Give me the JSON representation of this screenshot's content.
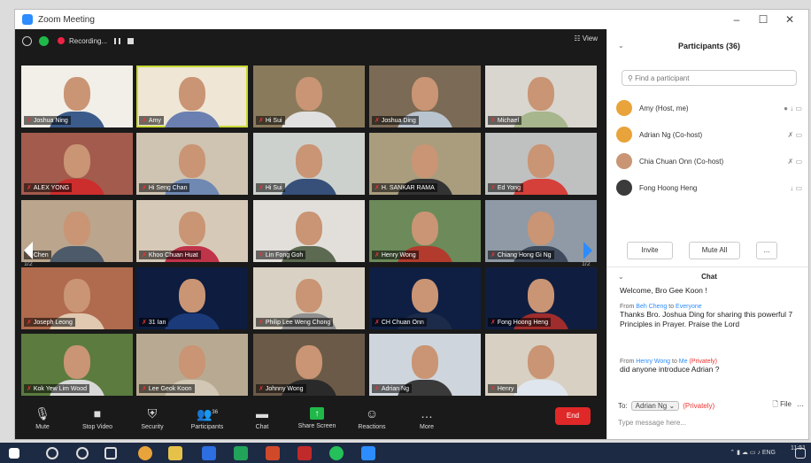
{
  "window": {
    "title": "Zoom Meeting"
  },
  "titlebar_controls": [
    "–",
    "☐",
    "✕"
  ],
  "top_bar": {
    "recording_label": "Recording...",
    "view_label": "View"
  },
  "tiles": [
    {
      "name": "Joshua Ning",
      "bg": "#f2efe8",
      "shirt": "#3b5b8a"
    },
    {
      "name": "Amy",
      "bg": "#efe6d6",
      "shirt": "#6b7fb0"
    },
    {
      "name": "Hi Sui",
      "bg": "#8a7a5c",
      "shirt": "#e0e0e0"
    },
    {
      "name": "Joshua Ding",
      "bg": "#7b6a55",
      "shirt": "#b9c4cf"
    },
    {
      "name": "Michael",
      "bg": "#d9d6cf",
      "shirt": "#a7b68c"
    },
    {
      "name": "ALEX YONG",
      "bg": "#a35b4e",
      "shirt": "#cc2d2d"
    },
    {
      "name": "Hi Seng Chan",
      "bg": "#cfc3b2",
      "shirt": "#6f89b3"
    },
    {
      "name": "Hi Sui",
      "bg": "#cdd1cd",
      "shirt": "#36507a"
    },
    {
      "name": "H. SANKAR RAMA",
      "bg": "#a99d7e",
      "shirt": "#333333"
    },
    {
      "name": "Ed Yong",
      "bg": "#bfc0c0",
      "shirt": "#d6403a"
    },
    {
      "name": "Chen",
      "bg": "#bba58d",
      "shirt": "#4c5a6a"
    },
    {
      "name": "Khoo Chuan Huat",
      "bg": "#d7c9b8",
      "shirt": "#c0344a"
    },
    {
      "name": "Lin Fong Goh",
      "bg": "#e2dfdb",
      "shirt": "#5d6a52"
    },
    {
      "name": "Henry Wong",
      "bg": "#6c8a5a",
      "shirt": "#b23b2e"
    },
    {
      "name": "Chiang Hong Gi Ng",
      "bg": "#8f9aa6",
      "shirt": "#3f4a5c"
    },
    {
      "name": "Joseph Leong",
      "bg": "#b06a4d",
      "shirt": "#e0c9b0"
    },
    {
      "name": "31 Ian",
      "bg": "#0d1c3f",
      "shirt": "#1b3a7a"
    },
    {
      "name": "Philip Lee Weng Chong",
      "bg": "#d9d2c4",
      "shirt": "#909090"
    },
    {
      "name": "CH Chuan Onn",
      "bg": "#0e1f43",
      "shirt": "#1d2b4a"
    },
    {
      "name": "Fong Hoong Heng",
      "bg": "#0f1e40",
      "shirt": "#a02d2d"
    },
    {
      "name": "Kok Yew Lim Wood",
      "bg": "#5b7b3f",
      "shirt": "#d8d8d8"
    },
    {
      "name": "Lee Geok Koon",
      "bg": "#b8aa92",
      "shirt": "#d2c7b4"
    },
    {
      "name": "Johnny Wong",
      "bg": "#6b5a48",
      "shirt": "#2a2a2a"
    },
    {
      "name": "Adrian Ng",
      "bg": "#cfd5dc",
      "shirt": "#3a3a3a"
    },
    {
      "name": "Henry",
      "bg": "#d8d0c2",
      "shirt": "#dfe6ee"
    }
  ],
  "page_indicator": [
    "1/2",
    "1/2"
  ],
  "toolbar": {
    "mute": "Mute",
    "stop_video": "Stop Video",
    "security": "Security",
    "participants": "Participants",
    "participants_count": "36",
    "chat": "Chat",
    "share": "Share Screen",
    "reactions": "Reactions",
    "more": "More",
    "end": "End"
  },
  "panel": {
    "title": "Participants (36)",
    "search_placeholder": "Find a participant",
    "participants": [
      {
        "name": "Amy (Host, me)",
        "icons": "● ↓ ▭",
        "avatar": "#e8a33a"
      },
      {
        "name": "Adrian Ng (Co-host)",
        "icons": "✗ ▭",
        "avatar": "#e8a33a"
      },
      {
        "name": "Chia Chuan Onn (Co-host)",
        "icons": "✗ ▭",
        "avatar": "#c99574"
      },
      {
        "name": "Fong Hoong Heng",
        "icons": "↓ ▭",
        "avatar": "#3b3b3b"
      }
    ],
    "invite": "Invite",
    "mute_all": "Mute All",
    "more": "..."
  },
  "chat": {
    "title": "Chat",
    "messages": [
      {
        "meta_from": "",
        "meta_to": "",
        "private": "",
        "text": "Welcome, Bro Gee Koon !"
      },
      {
        "meta_from": "Beh Cheng",
        "meta_to": "Everyone",
        "private": "",
        "text": "Thanks Bro. Joshua Ding for sharing this powerful 7 Principles in Prayer. Praise the Lord"
      },
      {
        "meta_from": "Henry Wong",
        "meta_to": "Me",
        "private": "(Privately)",
        "text": "did anyone introduce Adrian ?"
      }
    ],
    "to_label": "To:",
    "to_recipient": "Adrian Ng",
    "to_private": "(Privately)",
    "file_label": "File",
    "input_placeholder": "Type message here..."
  },
  "taskbar": {
    "lang": "ENG",
    "time": "11:51"
  }
}
